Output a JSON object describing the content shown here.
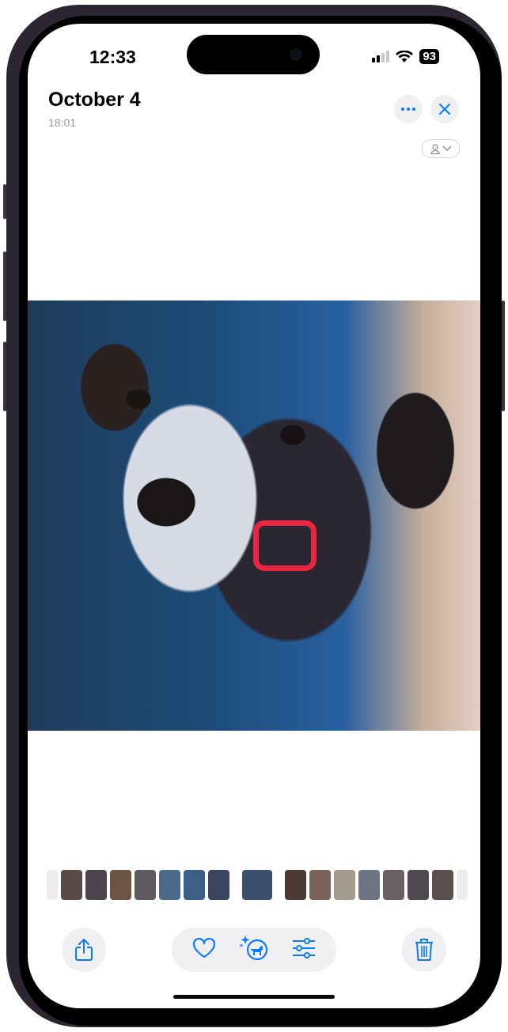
{
  "status_bar": {
    "time": "12:33",
    "battery": "93",
    "signal_bars_active": 2,
    "signal_bars_total": 4,
    "wifi": "wifi-icon"
  },
  "header": {
    "title": "October 4",
    "subtitle": "18:01",
    "more_button": "more-icon",
    "close_button": "close-icon",
    "people_selector": "person-icon"
  },
  "photo": {
    "subject": "dog portrait",
    "highlight_color": "#e8263f"
  },
  "thumbnails": {
    "left_count": 8,
    "right_count": 8,
    "colors": [
      "#d9d9d9",
      "#5a4a48",
      "#4b4550",
      "#6b5444",
      "#5e5a60",
      "#4a6a8a",
      "#3b5f85",
      "#3a4660",
      "#3c4f6e",
      "#4b3a34",
      "#7a6358",
      "#a49a90",
      "#6d7585",
      "#6a6064",
      "#4f4a52",
      "#5b4f4d",
      "#dcdcdc"
    ]
  },
  "toolbar": {
    "share": "share-icon",
    "favorite": "heart-icon",
    "visual_lookup": "visual-lookup-dog-icon",
    "adjust": "adjust-sliders-icon",
    "delete": "trash-icon",
    "accent_color": "#0a7aff"
  }
}
